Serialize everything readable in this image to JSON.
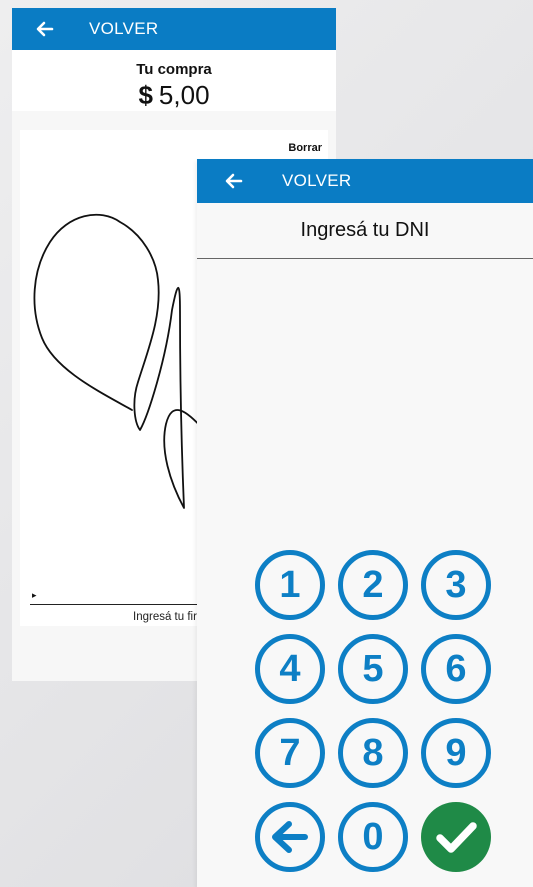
{
  "colors": {
    "appbar": "#0a7cc4",
    "keypad_ring": "#0d7fc5",
    "confirm": "#1f8a47"
  },
  "signature_screen": {
    "appbar": {
      "icon": "back-arrow-icon",
      "title": "VOLVER"
    },
    "summary": {
      "label": "Tu compra",
      "currency": "$",
      "amount": "5,00"
    },
    "clear_label": "Borrar",
    "marker": "▸",
    "hint": "Ingresá tu firma"
  },
  "dni_screen": {
    "appbar": {
      "icon": "back-arrow-icon",
      "title": "VOLVER"
    },
    "header": "Ingresá tu DNI",
    "value": "",
    "keys": [
      {
        "label": "1"
      },
      {
        "label": "2"
      },
      {
        "label": "3"
      },
      {
        "label": "4"
      },
      {
        "label": "5"
      },
      {
        "label": "6"
      },
      {
        "label": "7"
      },
      {
        "label": "8"
      },
      {
        "label": "9"
      },
      {
        "icon": "delete-arrow-icon"
      },
      {
        "label": "0"
      },
      {
        "icon": "check-icon"
      }
    ]
  }
}
